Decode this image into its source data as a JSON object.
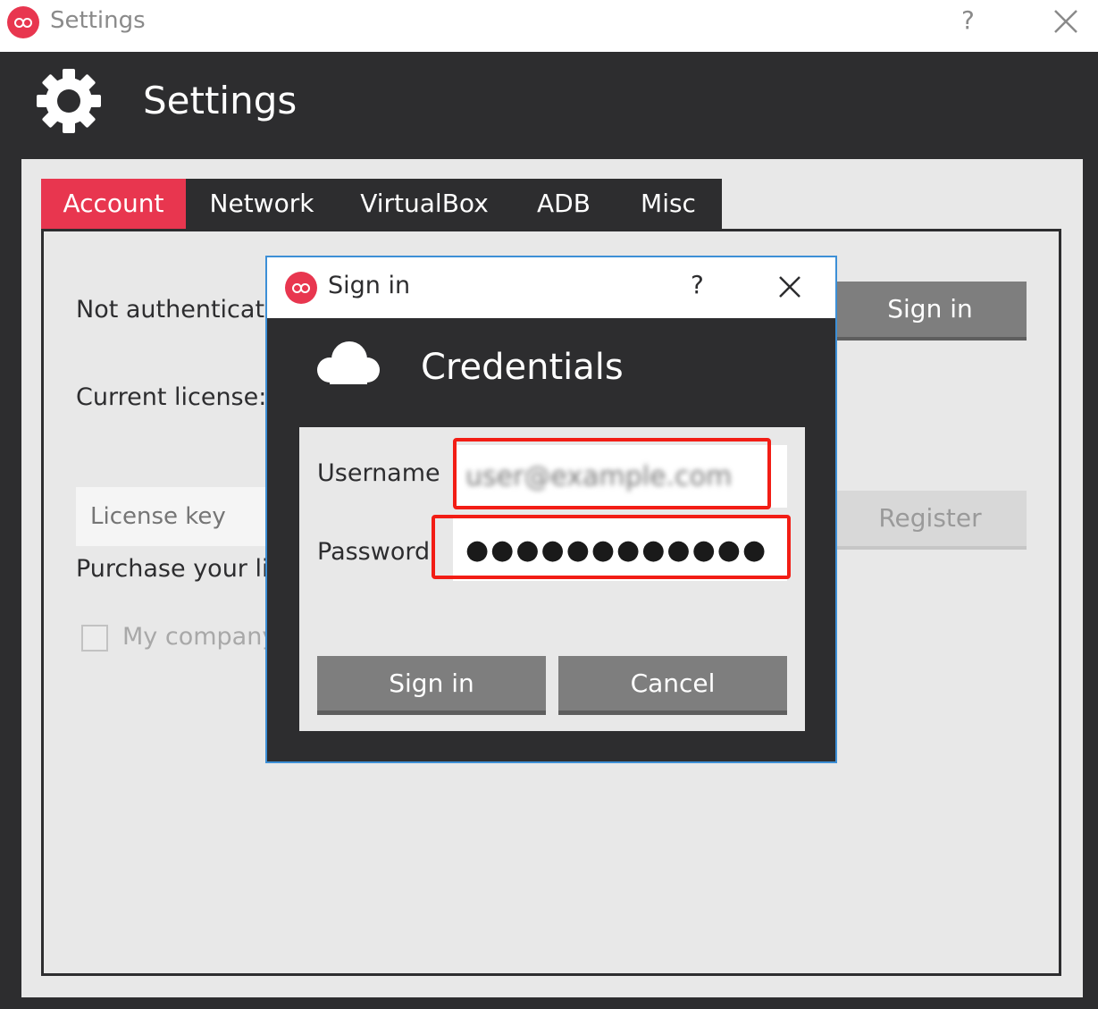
{
  "window": {
    "title": "Settings",
    "help_label": "?",
    "close_icon": "close-icon"
  },
  "header": {
    "icon": "gear-icon",
    "title": "Settings"
  },
  "tabs": [
    {
      "label": "Account",
      "active": true
    },
    {
      "label": "Network",
      "active": false
    },
    {
      "label": "VirtualBox",
      "active": false
    },
    {
      "label": "ADB",
      "active": false
    },
    {
      "label": "Misc",
      "active": false
    }
  ],
  "account": {
    "auth_status": "Not authenticate",
    "signin_button": "Sign in",
    "license_label": "Current license:",
    "license_placeholder": "License key",
    "register_button": "Register",
    "purchase_text": "Purchase your lic",
    "company_checkbox_label": "My company"
  },
  "dialog": {
    "title": "Sign in",
    "help_label": "?",
    "icon": "cloud-icon",
    "heading": "Credentials",
    "username_label": "Username",
    "username_value": "user@example.com",
    "password_label": "Password",
    "password_value": "●●●●●●●●●●●●",
    "signin_button": "Sign in",
    "cancel_button": "Cancel"
  },
  "colors": {
    "accent": "#e8364f",
    "dark": "#2d2d2f",
    "panel": "#e8e8e8",
    "button": "#7e7e7e",
    "highlight": "#f21d15",
    "dialog_border": "#3d8fd6"
  }
}
